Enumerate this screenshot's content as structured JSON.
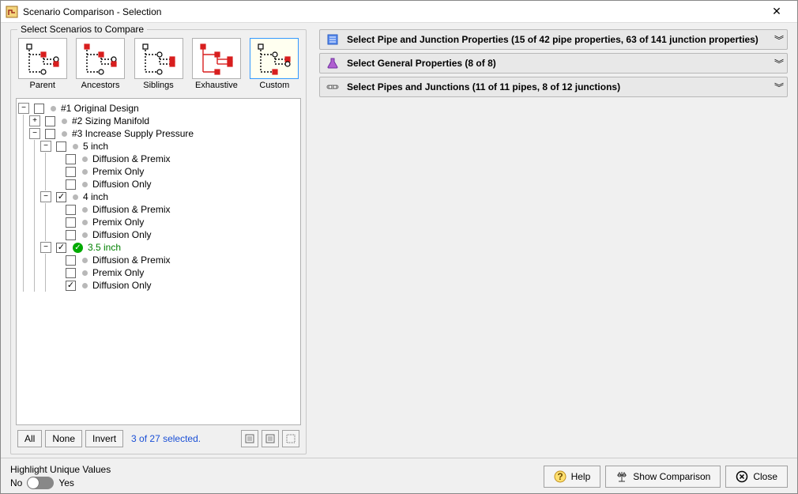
{
  "window": {
    "title": "Scenario Comparison - Selection"
  },
  "groupbox_label": "Select Scenarios to Compare",
  "modes": [
    {
      "id": "parent",
      "label": "Parent"
    },
    {
      "id": "ancestors",
      "label": "Ancestors"
    },
    {
      "id": "siblings",
      "label": "Siblings"
    },
    {
      "id": "exhaustive",
      "label": "Exhaustive"
    },
    {
      "id": "custom",
      "label": "Custom"
    }
  ],
  "selected_mode": "custom",
  "tree": [
    {
      "depth": 0,
      "expander": "-",
      "checked": false,
      "style": "folder",
      "label": "#1 Original Design"
    },
    {
      "depth": 1,
      "expander": "+",
      "checked": false,
      "style": "folder",
      "label": "#2 Sizing Manifold"
    },
    {
      "depth": 1,
      "expander": "-",
      "checked": false,
      "style": "folder",
      "label": "#3 Increase Supply Pressure"
    },
    {
      "depth": 2,
      "expander": "-",
      "checked": false,
      "style": "bullet",
      "label": "5 inch"
    },
    {
      "depth": 3,
      "expander": "",
      "checked": false,
      "style": "bullet",
      "label": "Diffusion & Premix"
    },
    {
      "depth": 3,
      "expander": "",
      "checked": false,
      "style": "bullet",
      "label": "Premix Only"
    },
    {
      "depth": 3,
      "expander": "",
      "checked": false,
      "style": "bullet",
      "label": "Diffusion Only"
    },
    {
      "depth": 2,
      "expander": "-",
      "checked": true,
      "style": "bullet",
      "label": "4 inch"
    },
    {
      "depth": 3,
      "expander": "",
      "checked": false,
      "style": "bullet",
      "label": "Diffusion & Premix"
    },
    {
      "depth": 3,
      "expander": "",
      "checked": false,
      "style": "bullet",
      "label": "Premix Only"
    },
    {
      "depth": 3,
      "expander": "",
      "checked": false,
      "style": "bullet",
      "label": "Diffusion Only"
    },
    {
      "depth": 2,
      "expander": "-",
      "checked": true,
      "style": "current",
      "label": "3.5 inch"
    },
    {
      "depth": 3,
      "expander": "",
      "checked": false,
      "style": "bullet",
      "label": "Diffusion & Premix"
    },
    {
      "depth": 3,
      "expander": "",
      "checked": false,
      "style": "bullet",
      "label": "Premix Only"
    },
    {
      "depth": 3,
      "expander": "",
      "checked": true,
      "style": "bullet",
      "label": "Diffusion Only"
    }
  ],
  "treefoot": {
    "all": "All",
    "none": "None",
    "invert": "Invert",
    "status": "3 of 27 selected."
  },
  "panels": [
    {
      "icon": "props",
      "label": "Select Pipe and Junction Properties (15 of 42  pipe properties, 63 of 141 junction properties)"
    },
    {
      "icon": "flask",
      "label": "Select General Properties (8 of 8)"
    },
    {
      "icon": "pipes",
      "label": "Select Pipes and Junctions (11 of 11  pipes, 8 of 12 junctions)"
    }
  ],
  "footer": {
    "highlight_label": "Highlight Unique Values",
    "no": "No",
    "yes": "Yes",
    "help": "Help",
    "show": "Show Comparison",
    "close": "Close"
  }
}
